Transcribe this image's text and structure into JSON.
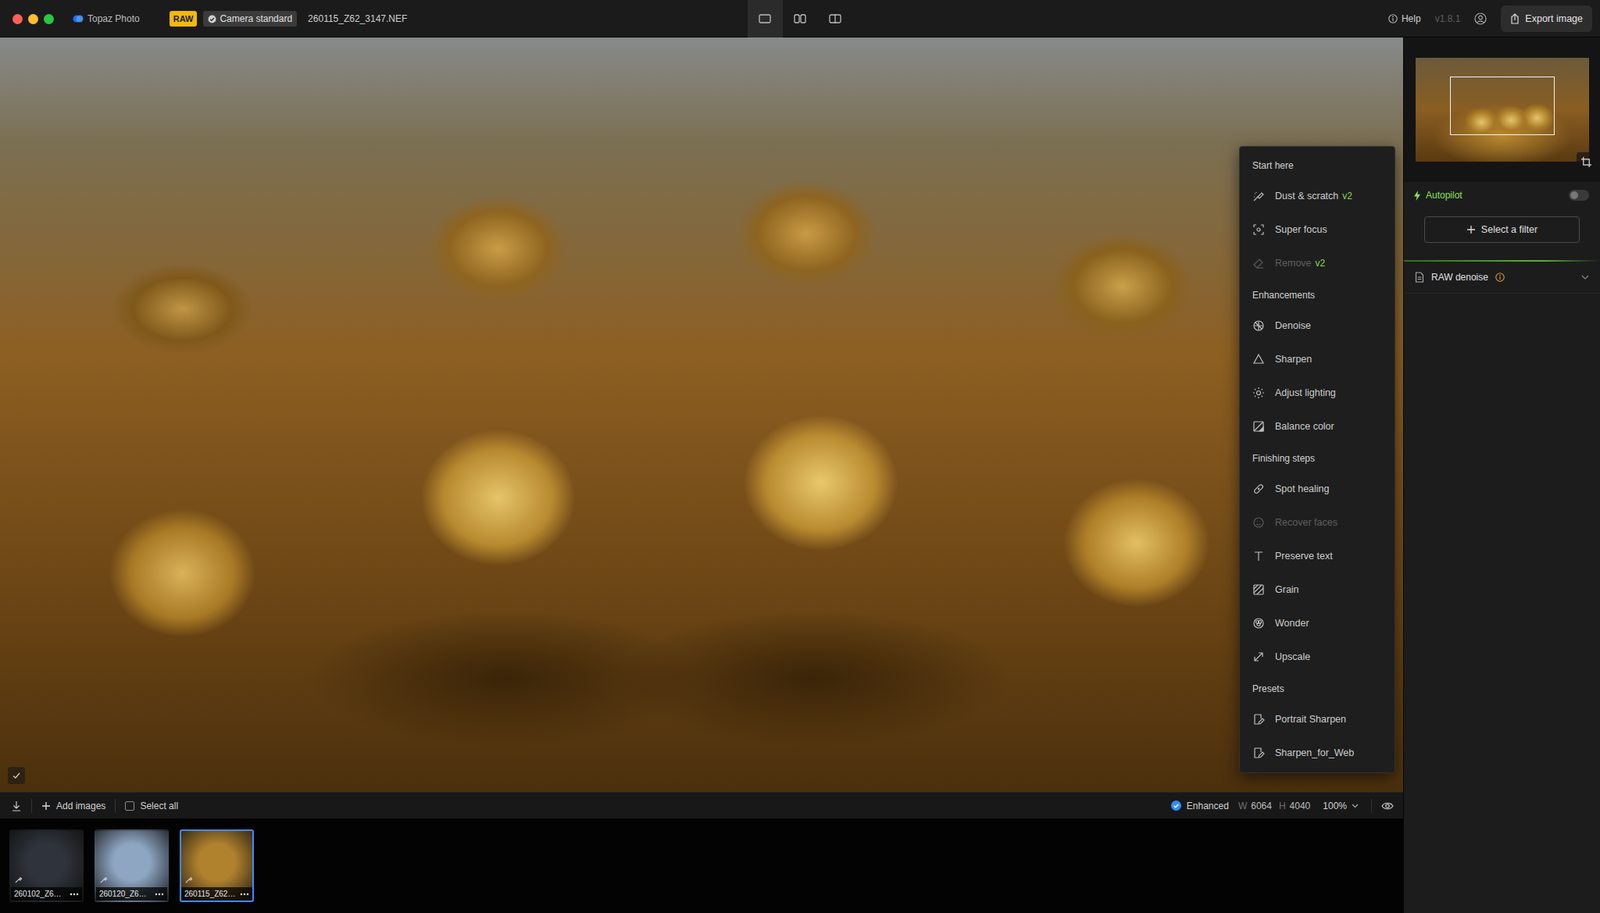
{
  "window": {
    "app": "Topaz Photo",
    "badge": "RAW",
    "profile": {
      "label": "Camera standard",
      "checked": true
    },
    "filename": "260115_Z62_3147.NEF"
  },
  "view_modes": [
    {
      "kind": "single",
      "selected": true
    },
    {
      "kind": "side-by-side",
      "selected": false
    },
    {
      "kind": "split",
      "selected": false
    }
  ],
  "header": {
    "help": "Help",
    "version": "v1.8.1",
    "export": "Export image"
  },
  "filter_menu": {
    "sections": [
      {
        "title": "Start here",
        "items": [
          {
            "label": "Dust & scratch",
            "badge": "v2",
            "disabled": false
          },
          {
            "label": "Super focus",
            "disabled": false
          },
          {
            "label": "Remove",
            "badge": "v2",
            "disabled": true
          }
        ]
      },
      {
        "title": "Enhancements",
        "items": [
          {
            "label": "Denoise",
            "disabled": false
          },
          {
            "label": "Sharpen",
            "disabled": false
          },
          {
            "label": "Adjust lighting",
            "disabled": false
          },
          {
            "label": "Balance color",
            "disabled": false
          }
        ]
      },
      {
        "title": "Finishing steps",
        "items": [
          {
            "label": "Spot healing",
            "disabled": false
          },
          {
            "label": "Recover faces",
            "disabled": true
          },
          {
            "label": "Preserve text",
            "disabled": false
          },
          {
            "label": "Grain",
            "disabled": false
          },
          {
            "label": "Wonder",
            "disabled": false
          },
          {
            "label": "Upscale",
            "disabled": false
          }
        ]
      },
      {
        "title": "Presets",
        "items": [
          {
            "label": "Portrait Sharpen",
            "disabled": false
          },
          {
            "label": "Sharpen_for_Web",
            "disabled": false
          }
        ]
      }
    ]
  },
  "panel": {
    "autopilot": {
      "label": "Autopilot",
      "on": false
    },
    "select_filter": "Select a filter",
    "filters": [
      {
        "label": "RAW denoise",
        "expanded": false
      }
    ]
  },
  "toolbar": {
    "add": "Add images",
    "select_all": {
      "label": "Select all",
      "checked": false
    },
    "enhanced": {
      "label": "Enhanced",
      "checked": true
    },
    "width_label": "W",
    "width": "6064",
    "height_label": "H",
    "height": "4040",
    "zoom": "100%"
  },
  "filmstrip": [
    {
      "label": "260102_Z6…",
      "selected": false,
      "color": "#2f343c"
    },
    {
      "label": "260120_Z6…",
      "selected": false,
      "color": "#8ea6c2"
    },
    {
      "label": "260115_Z62…",
      "selected": true,
      "color": "#b0822e"
    }
  ]
}
